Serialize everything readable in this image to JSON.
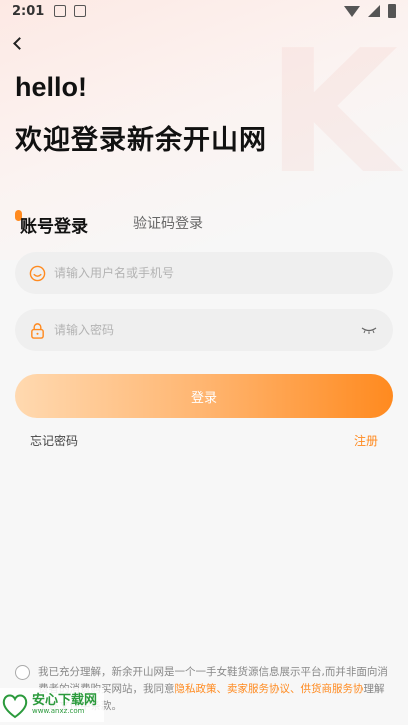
{
  "status_bar": {
    "time": "2:01"
  },
  "header": {
    "greeting": "hello!",
    "welcome": "欢迎登录新余开山网"
  },
  "tabs": [
    {
      "label": "账号登录",
      "active": true
    },
    {
      "label": "验证码登录",
      "active": false
    }
  ],
  "form": {
    "username_placeholder": "请输入用户名或手机号",
    "password_placeholder": "请输入密码",
    "login_label": "登录",
    "forgot_label": "忘记密码",
    "register_label": "注册"
  },
  "agreement": {
    "text_prefix": "我已充分理解，新余开山网是一个一手女鞋货源信息展示平台,而并非面向消费者的消费购买网站，我同意",
    "privacy": "隐私政策",
    "sep1": "、",
    "seller": "卖家服务协议",
    "sep2": "、",
    "supplier": "供货商服务协",
    "text_suffix": "理解上述文件中条款。"
  },
  "watermark": {
    "main": "安心下载网",
    "sub": "www.anxz.com"
  },
  "colors": {
    "accent": "#ff8a1f",
    "gradient_start": "#ffd9b0"
  }
}
